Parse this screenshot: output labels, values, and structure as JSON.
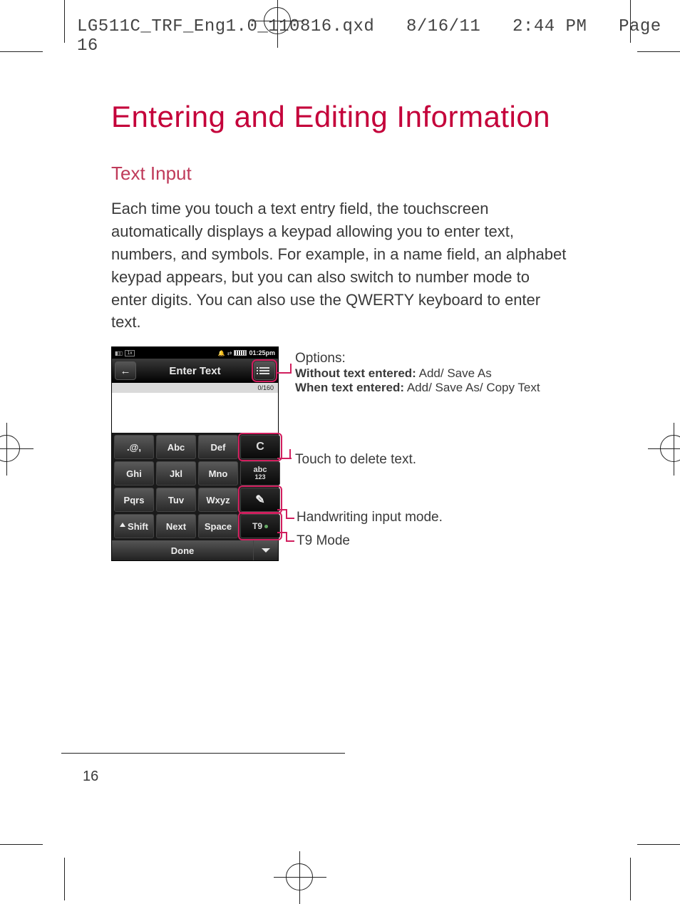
{
  "header": {
    "filename": "LG511C_TRF_Eng1.0_110816.qxd",
    "date": "8/16/11",
    "time": "2:44 PM",
    "page_label": "Page 16"
  },
  "title": "Entering and Editing Information",
  "section_title": "Text Input",
  "body_text": "Each time you touch a text entry field, the touchscreen automatically displays a keypad allowing you to enter text, numbers, and symbols. For example, in a name field, an alphabet keypad appears, but you can also switch to number mode to enter digits. You can also use the QWERTY keyboard to enter text.",
  "phone": {
    "status": {
      "network_mode": "1x",
      "time_text": "01:25pm",
      "bell": "🔔",
      "arrows": "⇄"
    },
    "nav": {
      "back_glyph": "←",
      "title": "Enter Text"
    },
    "counter": "0/160",
    "keys": {
      "sym": ".@,",
      "abc": "Abc",
      "def": "Def",
      "clear": "C",
      "ghi": "Ghi",
      "jkl": "Jkl",
      "mno": "Mno",
      "mode_top": "abc",
      "mode_bot": "123",
      "pqrs": "Pqrs",
      "tuv": "Tuv",
      "wxyz": "Wxyz",
      "shift": "Shift",
      "next": "Next",
      "space": "Space",
      "t9": "T9"
    },
    "done": "Done"
  },
  "callouts": {
    "options_title": "Options:",
    "options_l1_label": "Without text entered:",
    "options_l1_val": " Add/ Save As",
    "options_l2_label": "When text entered:",
    "options_l2_val": " Add/ Save As/ Copy Text",
    "delete": "Touch to delete text.",
    "handwriting": "Handwriting input mode.",
    "t9mode": "T9 Mode"
  },
  "page_number": "16"
}
